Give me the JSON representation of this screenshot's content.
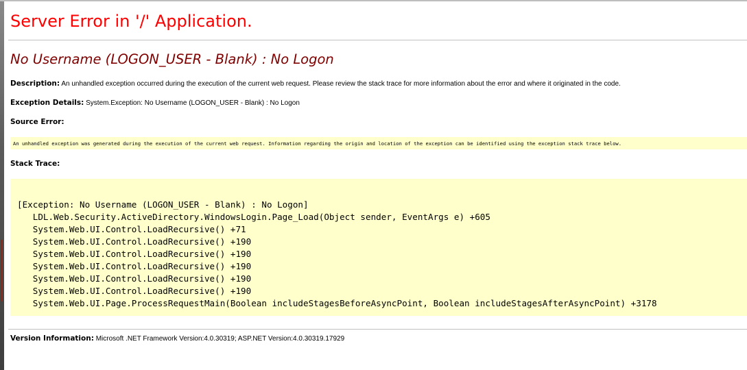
{
  "page": {
    "title": "Server Error in '/' Application.",
    "error_heading": "No Username (LOGON_USER - Blank) : No Logon"
  },
  "description": {
    "label": "Description:",
    "text": " An unhandled exception occurred during the execution of the current web request. Please review the stack trace for more information about the error and where it originated in the code."
  },
  "exception_details": {
    "label": "Exception Details:",
    "text": " System.Exception: No Username (LOGON_USER - Blank) : No Logon"
  },
  "source_error": {
    "label": "Source Error:",
    "text": "An unhandled exception was generated during the execution of the current web request. Information regarding the origin and location of the exception can be identified using the exception stack trace below."
  },
  "stack_trace": {
    "label": "Stack Trace:",
    "lines": [
      "[Exception: No Username (LOGON_USER - Blank) : No Logon]",
      "   LDL.Web.Security.ActiveDirectory.WindowsLogin.Page_Load(Object sender, EventArgs e) +605",
      "   System.Web.UI.Control.LoadRecursive() +71",
      "   System.Web.UI.Control.LoadRecursive() +190",
      "   System.Web.UI.Control.LoadRecursive() +190",
      "   System.Web.UI.Control.LoadRecursive() +190",
      "   System.Web.UI.Control.LoadRecursive() +190",
      "   System.Web.UI.Control.LoadRecursive() +190",
      "   System.Web.UI.Page.ProcessRequestMain(Boolean includeStagesBeforeAsyncPoint, Boolean includeStagesAfterAsyncPoint) +3178"
    ]
  },
  "version_information": {
    "label": "Version Information:",
    "text": " Microsoft .NET Framework Version:4.0.30319; ASP.NET Version:4.0.30319.17929"
  },
  "colors": {
    "title": "#ff0000",
    "error_heading": "#800000",
    "code_background": "#ffffcc"
  }
}
